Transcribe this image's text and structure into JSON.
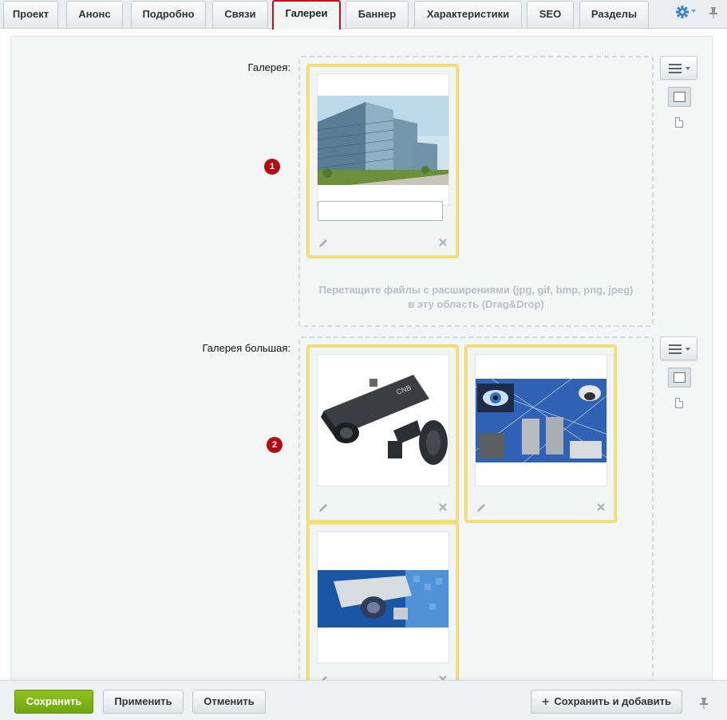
{
  "tabs": [
    {
      "label": "Проект"
    },
    {
      "label": "Анонс"
    },
    {
      "label": "Подробно"
    },
    {
      "label": "Связи"
    },
    {
      "label": "Галереи",
      "active": true
    },
    {
      "label": "Баннер"
    },
    {
      "label": "Характеристики"
    },
    {
      "label": "SEO"
    },
    {
      "label": "Разделы"
    }
  ],
  "toolbar_icons": {
    "settings": "gear-icon",
    "pin": "pin-icon"
  },
  "sections": [
    {
      "label": "Галерея:",
      "badge": "1",
      "images": [
        "building-photo"
      ],
      "dropzone_hint_line1": "Перетащите файлы с расширениями (jpg, gif, bmp, png, jpeg)",
      "dropzone_hint_line2": "в эту область (Drag&Drop)"
    },
    {
      "label": "Галерея большая:",
      "badge": "2",
      "images": [
        "cctv-camera-photo",
        "security-collage-photo",
        "camera-blue-photo"
      ]
    }
  ],
  "footer": {
    "save": "Сохранить",
    "apply": "Применить",
    "cancel": "Отменить",
    "save_add": "Сохранить и добавить"
  },
  "colors": {
    "accent_green": "#7ab317",
    "badge_red": "#b00b14",
    "card_border": "#f2e27b",
    "active_tab_border": "#c4101c"
  }
}
